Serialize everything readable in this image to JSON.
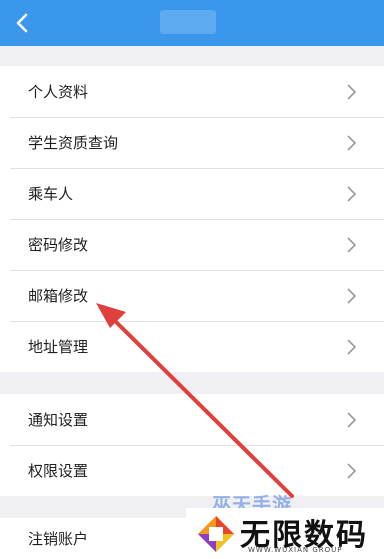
{
  "header": {
    "back_icon": "chevron-left-icon",
    "color": "#3a97ec"
  },
  "menu_group_1": [
    {
      "label": "个人资料"
    },
    {
      "label": "学生资质查询"
    },
    {
      "label": "乘车人"
    },
    {
      "label": "密码修改"
    },
    {
      "label": "邮箱修改"
    },
    {
      "label": "地址管理"
    }
  ],
  "menu_group_2": [
    {
      "label": "通知设置"
    },
    {
      "label": "权限设置"
    }
  ],
  "menu_group_3": [
    {
      "label": "注销账户"
    }
  ],
  "annotation": {
    "color": "#e0403c",
    "points_to": "邮箱修改"
  },
  "watermark": {
    "top_text": "巫天手游",
    "main_text": "无限数码",
    "sub_text": "WWW.WUXIAN GROUP"
  }
}
